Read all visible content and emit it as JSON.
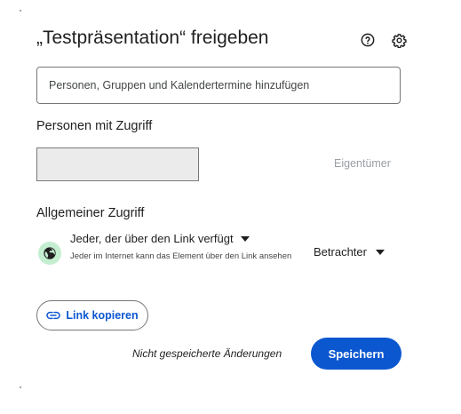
{
  "dialog": {
    "title": "„Testpräsentation“ freigeben",
    "search_placeholder": "Personen, Gruppen und Kalendertermine hinzufügen",
    "people_section_label": "Personen mit Zugriff",
    "owner_label": "Eigentümer",
    "general_access_label": "Allgemeiner Zugriff",
    "access": {
      "selected": "Jeder, der über den Link verfügt",
      "description": "Jeder im Internet kann das Element über den Link ansehen",
      "role": "Betrachter"
    },
    "copy_link_label": "Link kopieren",
    "unsaved_text": "Nicht gespeicherte Änderungen",
    "save_label": "Speichern"
  },
  "icons": {
    "help": "help-circle-icon",
    "settings": "gear-icon",
    "globe": "globe-icon",
    "link": "link-icon",
    "dropdown": "dropdown-triangle-icon"
  },
  "colors": {
    "primary": "#0b57d0",
    "globe_bg": "#c4eed0",
    "text": "#1f1f1f",
    "muted": "#9aa0a6"
  }
}
